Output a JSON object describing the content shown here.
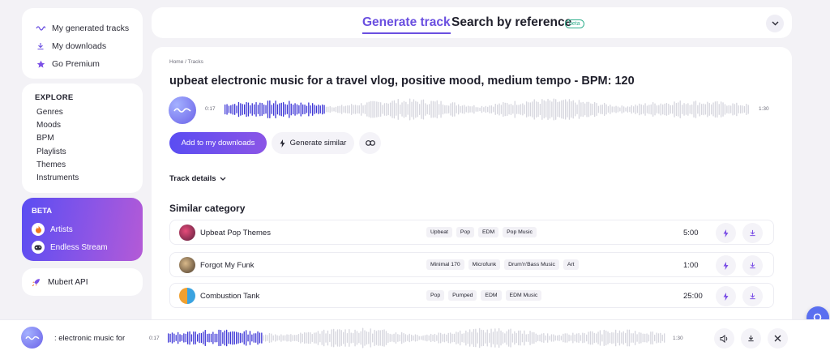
{
  "colors": {
    "accent": "#6a4fe0",
    "played": "#3b34d6",
    "unplayed": "#d6d6de",
    "beta_tag": "#2fae8c"
  },
  "sidebar": {
    "library": [
      {
        "label": "My generated tracks",
        "icon": "wave-icon"
      },
      {
        "label": "My downloads",
        "icon": "download-icon"
      },
      {
        "label": "Go Premium",
        "icon": "star-icon"
      }
    ],
    "explore": {
      "title": "EXPLORE",
      "items": [
        "Genres",
        "Moods",
        "BPM",
        "Playlists",
        "Themes",
        "Instruments"
      ]
    },
    "beta": {
      "title": "BETA",
      "items": [
        {
          "label": "Artists",
          "icon": "flame-icon"
        },
        {
          "label": "Endless Stream",
          "icon": "gamepad-icon"
        }
      ]
    },
    "api": {
      "label": "Mubert API",
      "icon": "rocket-icon"
    }
  },
  "header": {
    "tab_generate": "Generate track",
    "tab_search": "Search by reference",
    "beta_badge": "beta"
  },
  "main": {
    "breadcrumb": "Home  /  Tracks",
    "title": "upbeat electronic music for a travel vlog, positive mood, medium tempo - BPM: 120",
    "player": {
      "current": "0:17",
      "total": "1:30",
      "progress": 0.19
    },
    "buttons": {
      "add": "Add to my downloads",
      "similar": "Generate similar"
    },
    "details": "Track details",
    "similar_title": "Similar category",
    "rows": [
      {
        "name": "Upbeat Pop Themes",
        "tags": [
          "Upbeat",
          "Pop",
          "EDM",
          "Pop Music"
        ],
        "duration": "5:00"
      },
      {
        "name": "Forgot My Funk",
        "tags": [
          "Minimal 170",
          "Microfunk",
          "Drum'n'Bass Music",
          "Art"
        ],
        "duration": "1:00"
      },
      {
        "name": "Combustion Tank",
        "tags": [
          "Pop",
          "Pumped",
          "EDM",
          "EDM Music"
        ],
        "duration": "25:00"
      }
    ]
  },
  "bottom_player": {
    "name": ": electronic music for",
    "current": "0:17",
    "total": "1:30",
    "progress": 0.19
  }
}
